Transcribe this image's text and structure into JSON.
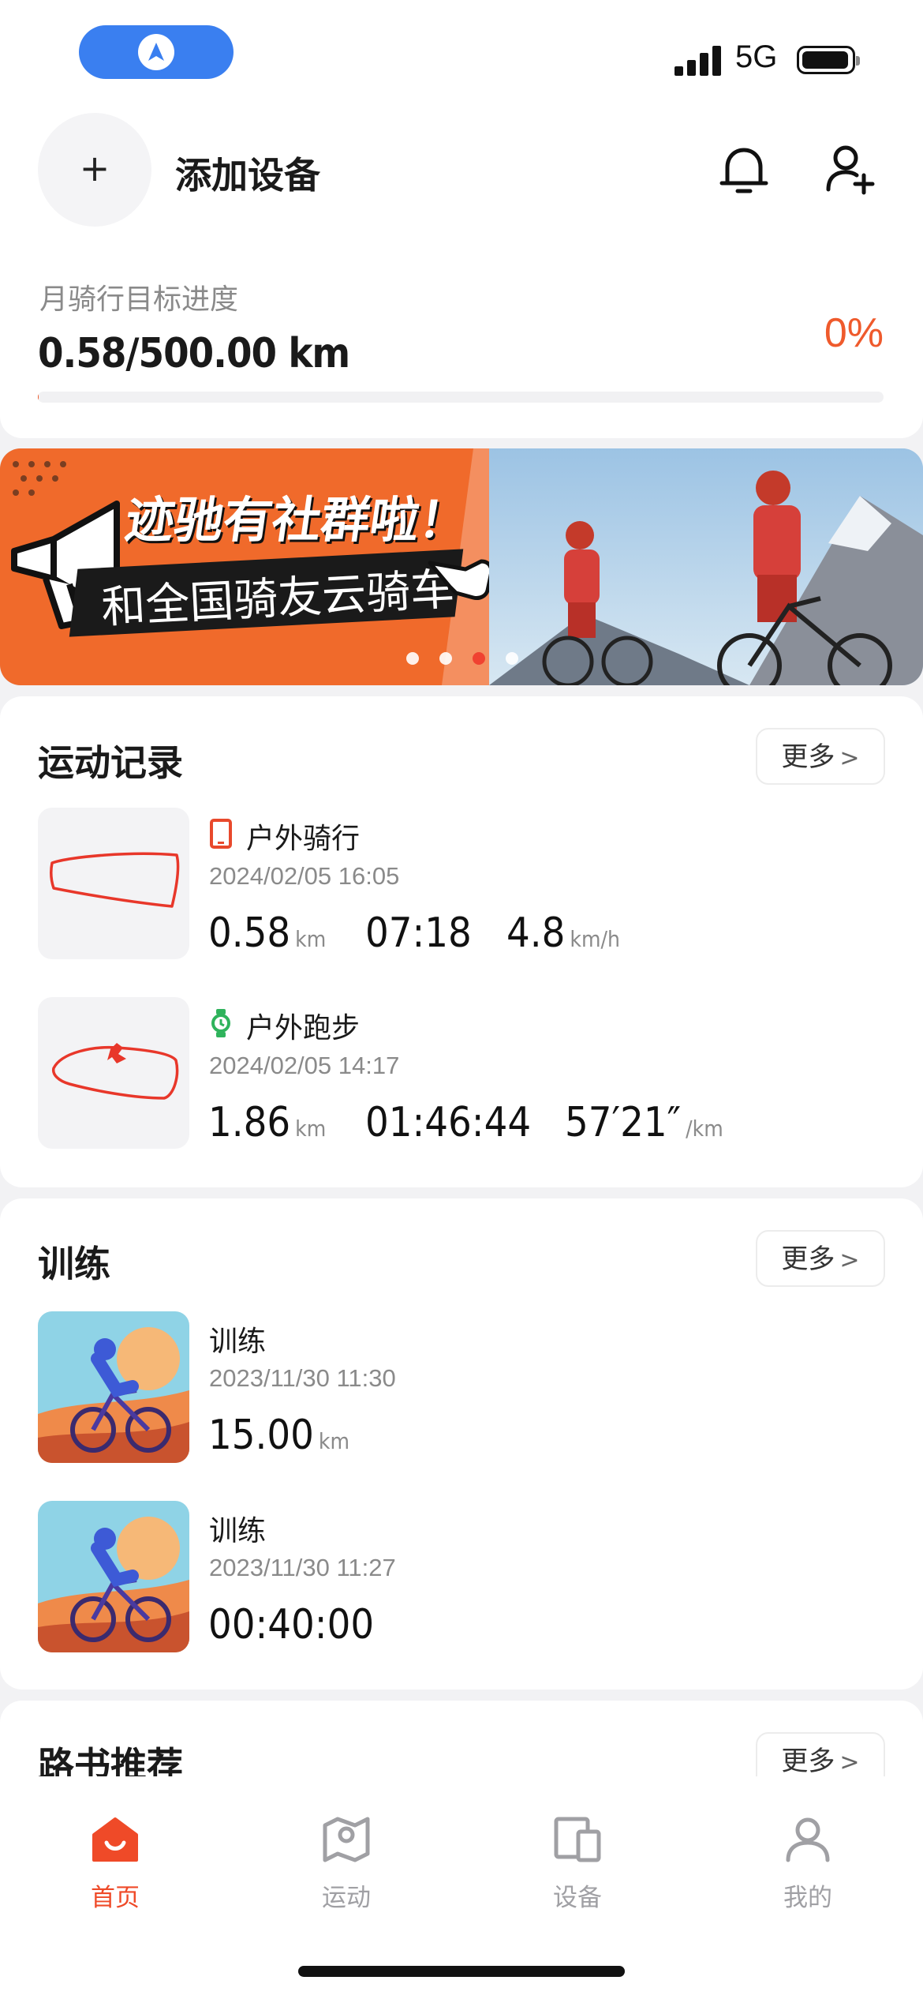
{
  "status_bar": {
    "network": "5G"
  },
  "header": {
    "add_device_label": "添加设备",
    "add_symbol": "+"
  },
  "goal": {
    "label": "月骑行目标进度",
    "value": "0.58/500.00 km",
    "percent": "0%",
    "progress_fraction": 0.0012
  },
  "banner": {
    "headline": "迹驰有社群啦！",
    "subline": "和全国骑友云骑车",
    "slide_count": 4,
    "active_slide": 3
  },
  "records": {
    "title": "运动记录",
    "more_label": "更多",
    "items": [
      {
        "type": "户外骑行",
        "date": "2024/02/05 16:05",
        "distance": "0.58",
        "distance_unit": "km",
        "duration": "07:18",
        "speed": "4.8",
        "speed_unit": "km/h"
      },
      {
        "type": "户外跑步",
        "date": "2024/02/05 14:17",
        "distance": "1.86",
        "distance_unit": "km",
        "duration": "01:46:44",
        "speed": "57′21″",
        "speed_unit": "/km"
      }
    ]
  },
  "training": {
    "title": "训练",
    "more_label": "更多",
    "items": [
      {
        "name": "训练",
        "date": "2023/11/30 11:30",
        "value": "15.00",
        "unit": "km"
      },
      {
        "name": "训练",
        "date": "2023/11/30 11:27",
        "value": "00:40:00",
        "unit": ""
      }
    ]
  },
  "routes": {
    "title": "路书推荐",
    "more_label": "更多"
  },
  "tabs": [
    {
      "label": "首页",
      "icon": "home-icon",
      "active": true
    },
    {
      "label": "运动",
      "icon": "map-icon",
      "active": false
    },
    {
      "label": "设备",
      "icon": "devices-icon",
      "active": false
    },
    {
      "label": "我的",
      "icon": "profile-icon",
      "active": false
    }
  ],
  "colors": {
    "accent": "#ef5a2c",
    "nav_pill": "#3a7ff0",
    "riding_icon": "#e8492c",
    "running_icon": "#2fb35c"
  }
}
